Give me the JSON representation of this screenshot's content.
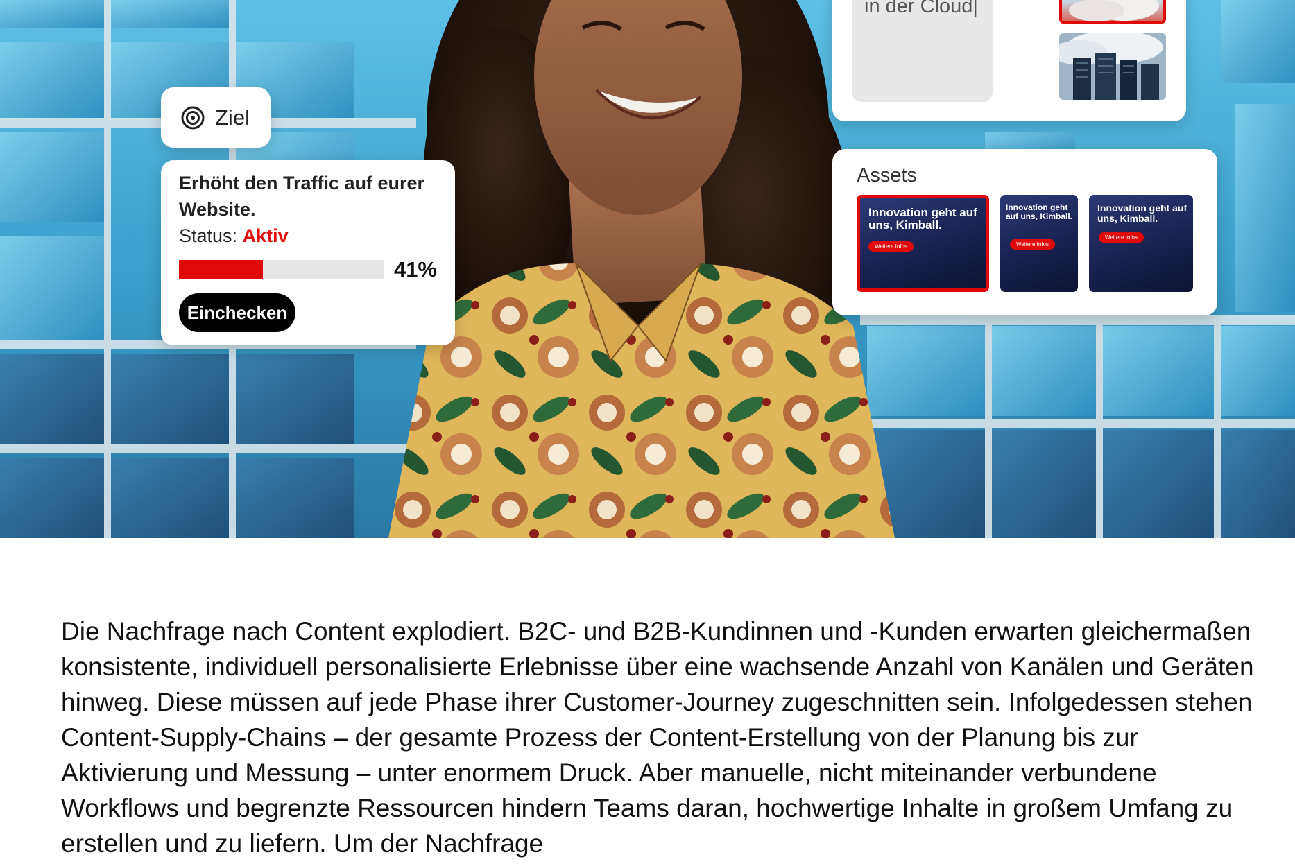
{
  "goal": {
    "chip_label": "Ziel",
    "title": "Erhöht den Traffic auf eurer Website.",
    "status_label": "Status:",
    "status_value": "Aktiv",
    "progress": 0.41,
    "progress_text": "41%",
    "checkin_label": "Einchecken"
  },
  "cloud": {
    "text": "in der Cloud|"
  },
  "assets": {
    "title": "Assets",
    "items": [
      {
        "headline": "Innovation geht auf uns, Kimball.",
        "cta": "Weitere Infos",
        "selected": true
      },
      {
        "headline": "Innovation geht auf uns, Kimball.",
        "cta": "Weitere Infos",
        "selected": false
      },
      {
        "headline": "Innovation geht auf uns, Kimball.",
        "cta": "Weitere Infos",
        "selected": false
      }
    ]
  },
  "body": {
    "paragraph": "Die Nachfrage nach Content explodiert. B2C- und B2B-Kundinnen und -Kunden erwarten gleichermaßen konsistente, individuell personalisierte Erlebnisse über eine wachsende Anzahl von Kanälen und Geräten hinweg. Diese müssen auf jede Phase ihrer Customer-Journey zugeschnitten sein. Infolgedessen stehen Content-Supply-Chains – der gesamte Prozess der Content-Erstellung von der Planung bis zur Aktivierung und Messung – unter enormem Druck. Aber manuelle, nicht miteinander verbundene Workflows und begrenzte Ressourcen hindern Teams daran, hochwertige Inhalte in großem Umfang zu erstellen und zu liefern. Um der Nachfrage"
  },
  "colors": {
    "accent_red": "#e10a0a",
    "button_black": "#000000",
    "progress_track": "#e6e6e6"
  }
}
